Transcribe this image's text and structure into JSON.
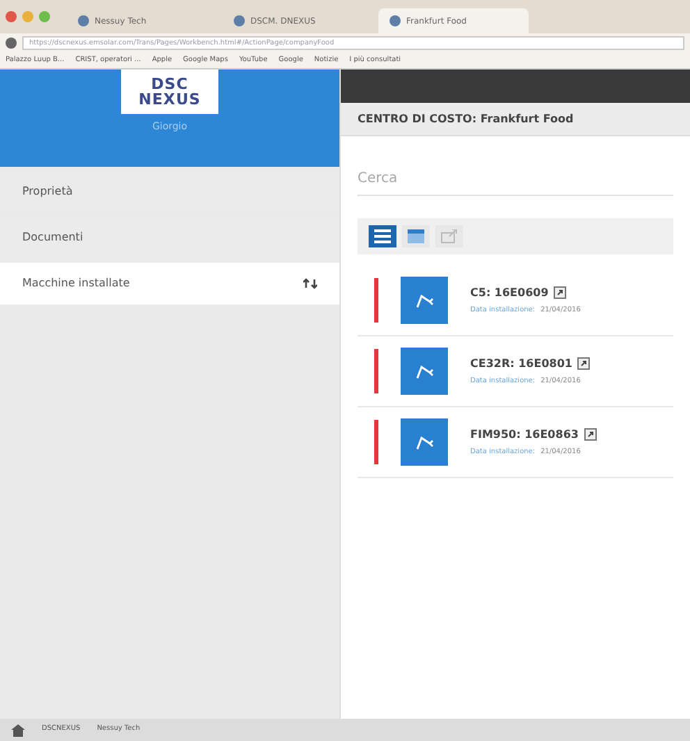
{
  "browser": {
    "tabs": [
      {
        "label": "Nessuy Tech",
        "selected": false
      },
      {
        "label": "DSCM. DNEXUS",
        "selected": false
      },
      {
        "label": "Frankfurt Food",
        "selected": true
      }
    ],
    "url": "https://dscnexus.emsolar.com/Trans/Pages/Workbench.html#/ActionPage/companyFood",
    "bookmarks": [
      "Palazzo Luup B...",
      "CRIST, operatori ...",
      "Apple",
      "Google Maps",
      "YouTube",
      "Google",
      "Notizie",
      "I più consultati"
    ]
  },
  "sidebar": {
    "logo": [
      "DSC",
      "NEXUS"
    ],
    "user": "Giorgio",
    "items": [
      {
        "label": "Proprietà",
        "selected": false
      },
      {
        "label": "Documenti",
        "selected": false
      },
      {
        "label": "Macchine installate",
        "selected": true
      }
    ]
  },
  "header": {
    "title": "CENTRO DI COSTO: Frankfurt Food"
  },
  "search": {
    "placeholder": "Cerca"
  },
  "view_buttons": [
    {
      "kind": "list",
      "selected": true
    },
    {
      "kind": "card",
      "selected": false
    },
    {
      "kind": "export",
      "selected": false
    }
  ],
  "machines": [
    {
      "title": "C5: 16E0609",
      "date_label": "Data installazione:",
      "date": "21/04/2016"
    },
    {
      "title": "CE32R: 16E0801",
      "date_label": "Data installazione:",
      "date": "21/04/2016"
    },
    {
      "title": "FIM950: 16E0863",
      "date_label": "Data installazione:",
      "date": "21/04/2016"
    }
  ],
  "taskbar": [
    "DSCNEXUS",
    "Nessuy Tech"
  ]
}
